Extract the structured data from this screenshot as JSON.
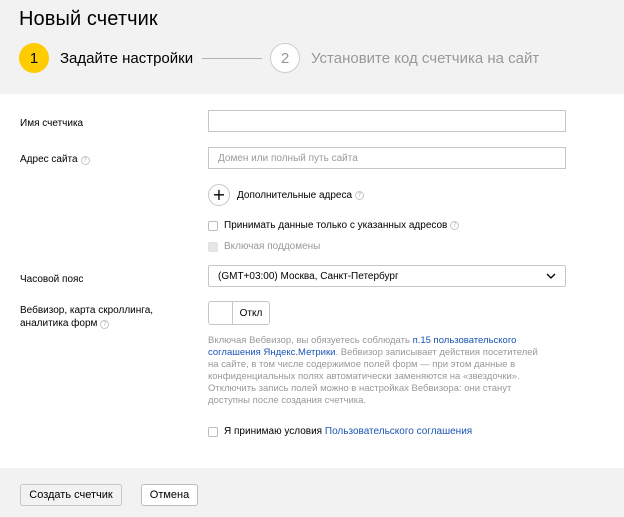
{
  "page": {
    "title": "Новый счетчик"
  },
  "steps": [
    {
      "number": "1",
      "label": "Задайте настройки",
      "active": true
    },
    {
      "number": "2",
      "label": "Установите код счетчика на сайт",
      "active": false
    }
  ],
  "form": {
    "counter_name": {
      "label": "Имя счетчика",
      "value": ""
    },
    "site_address": {
      "label": "Адрес сайта",
      "placeholder": "Домен или полный путь сайта",
      "help_icon": "question-icon"
    },
    "add_addresses_label": "Дополнительные адреса",
    "only_listed_label": "Принимать данные только с указанных адресов",
    "subdomains_label": "Включая поддомены",
    "timezone": {
      "label": "Часовой пояс",
      "value": "(GMT+03:00) Москва, Санкт-Петербург"
    },
    "webvisor": {
      "label_line1": "Вебвизор, карта скроллинга,",
      "label_line2": "аналитика форм",
      "toggle_label": "Откл"
    },
    "description": {
      "part1": "Включая Вебвизор, вы обязуетесь соблюдать ",
      "link1": "п.15 пользовательского соглашения Яндекс.Метрики",
      "part2": ". Вебвизор записывает действия посетителей на сайте, в том числе содержимое полей форм — при этом данные в конфиденциальных полях автоматически заменяются на «звездочки». Отключить запись полей можно в настройках Вебвизора: они станут доступны после создания счетчика."
    },
    "agreement": {
      "text": "Я принимаю условия ",
      "link": "Пользовательского соглашения"
    }
  },
  "footer": {
    "create_label": "Создать счетчик",
    "cancel_label": "Отмена"
  },
  "colors": {
    "accent": "#ffcc00",
    "link": "#1a55b4"
  }
}
